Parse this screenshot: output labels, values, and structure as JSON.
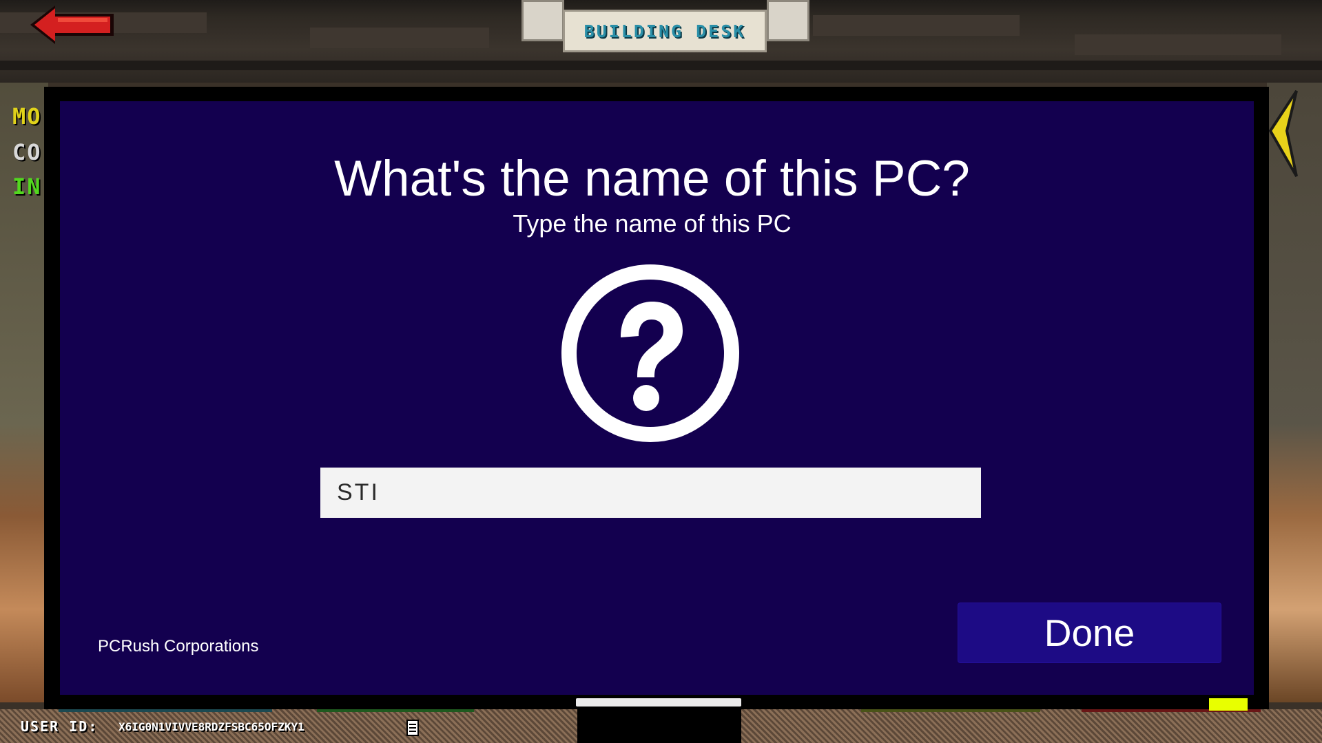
{
  "header": {
    "title": "BUILDING DESK",
    "back_icon": "back-arrow-icon"
  },
  "side_stats": {
    "line1": "MO",
    "line2": "CO",
    "line3": "IN"
  },
  "modal": {
    "title": "What's the name of this PC?",
    "subtitle": "Type the name of this PC",
    "icon": "question-mark-circle-icon",
    "input_value": "STI",
    "company": "PCRush Corporations",
    "done_label": "Done"
  },
  "footer": {
    "user_id_label": "USER ID:",
    "user_id_value": "X6IG0N1VIVVE8RDZFSBC65OFZKY1",
    "copy_icon": "copy-document-icon"
  },
  "colors": {
    "modal_bg": "#13004f",
    "done_button": "#1d0b85",
    "title_plate_text": "#2a8fa8",
    "stat_yellow": "#e0d21a",
    "stat_white": "#d8d8d8",
    "stat_green": "#52d81f",
    "back_arrow": "#d42020"
  }
}
